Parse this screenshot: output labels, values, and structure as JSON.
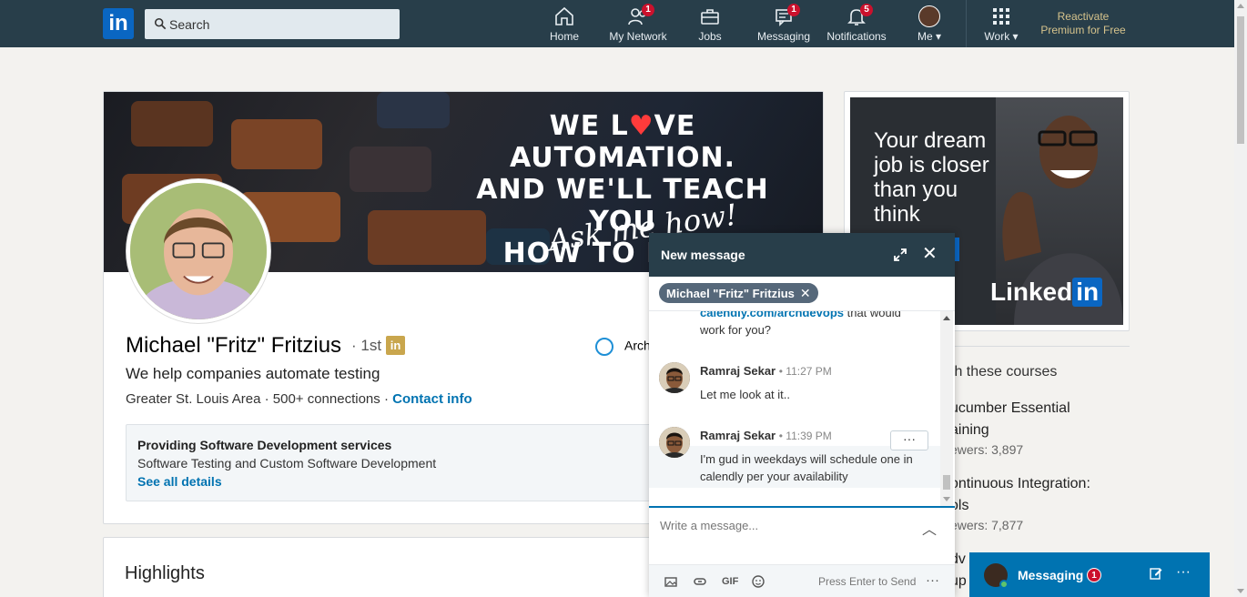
{
  "nav": {
    "logo_text": "in",
    "search_placeholder": "Search",
    "items": [
      {
        "label": "Home",
        "badge": ""
      },
      {
        "label": "My Network",
        "badge": "1"
      },
      {
        "label": "Jobs",
        "badge": ""
      },
      {
        "label": "Messaging",
        "badge": "1"
      },
      {
        "label": "Notifications",
        "badge": "5"
      },
      {
        "label": "Me",
        "badge": ""
      },
      {
        "label": "Work",
        "badge": ""
      }
    ],
    "premium_line1": "Reactivate",
    "premium_line2": "Premium for Free"
  },
  "profile": {
    "banner_line1": "WE L",
    "banner_heart": "♥",
    "banner_line1_end": "VE AUTOMATION.",
    "banner_line2": "AND WE'LL TEACH YOU",
    "banner_line3": "HOW TO DO IT.",
    "banner_sub": "Ask me how!",
    "name": "Michael \"Fritz\" Fritzius",
    "degree": "· 1st",
    "degree_badge": "in",
    "headline": "We help companies automate testing",
    "location": "Greater St. Louis Area",
    "connections": "500+ connections",
    "contact_link": "Contact info",
    "company": "Arch",
    "services_title": "Providing Software Development services",
    "services_desc": "Software Testing and Custom Software Development",
    "services_link": "See all details"
  },
  "highlights": {
    "title": "Highlights"
  },
  "ad": {
    "text": "Your dream job is closer than you think",
    "logo_word": "Linked",
    "logo_in": "in"
  },
  "courses": {
    "heading": "th these courses",
    "items": [
      {
        "title_line1": "ucumber Essential",
        "title_line2": "aining",
        "views": "ewers: 3,897"
      },
      {
        "title_line1": "ontinuous Integration:",
        "title_line2": "ols",
        "views": "ewers: 7,877"
      }
    ],
    "partial": "dv",
    "partial2": "up"
  },
  "message_window": {
    "title": "New message",
    "recipient": "Michael \"Fritz\" Fritzius",
    "continued_link": "calendly.com/archdevops",
    "continued_text_1": " that would",
    "continued_text_2": "work for you?",
    "messages": [
      {
        "sender": "Ramraj Sekar",
        "time": "• 11:27 PM",
        "text": "Let me look at it.."
      },
      {
        "sender": "Ramraj Sekar",
        "time": "• 11:39 PM",
        "text": "I'm gud in weekdays will schedule one in calendly per your availability"
      }
    ],
    "more_label": "···",
    "compose_placeholder": "Write a message...",
    "send_hint": "Press Enter to Send",
    "gif_label": "GIF"
  },
  "messaging_bar": {
    "label": "Messaging",
    "badge": "1"
  },
  "colors": {
    "nav_bg": "#283e4a",
    "accent": "#0073b1",
    "badge_red": "#cb112d",
    "premium_gold": "#d6c38c"
  }
}
